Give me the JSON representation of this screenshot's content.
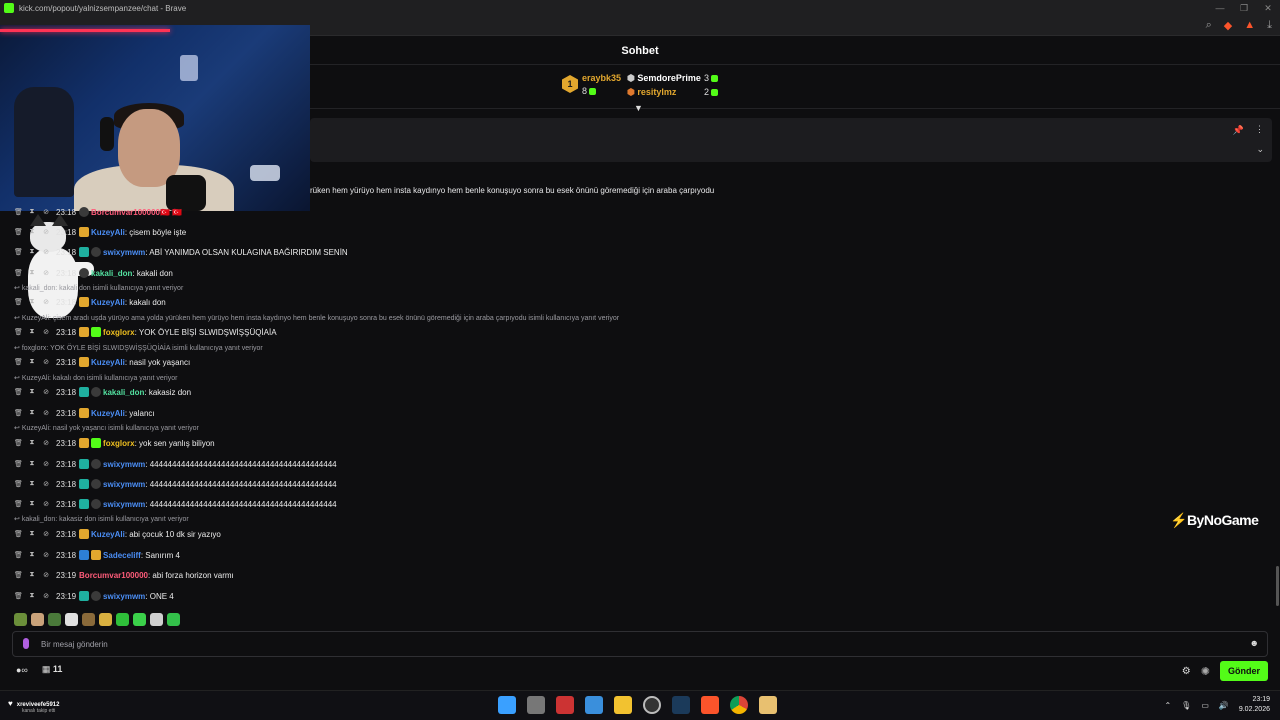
{
  "browser": {
    "title": "kick.com/popout/yalnizsempanzee/chat - Brave",
    "controls": [
      "—",
      "❐",
      "✕"
    ]
  },
  "chat": {
    "header": "Sohbet",
    "leaderboard": {
      "rank": "1",
      "first": {
        "name": "eraybk35",
        "count": "8"
      },
      "second": {
        "name": "SemdorePrime",
        "count": "3"
      },
      "third": {
        "name": "resitylmz",
        "count": "2"
      }
    },
    "long_message": "rüken hem yürüyo hem insta kaydınyo hem benle konuşuyo sonra bu esek önünü göremediği için araba çarpıyodu",
    "messages": [
      {
        "time": "23:18",
        "name": "Borcumvar100000",
        "color": "#ff5c7a",
        "text": "🇹🇷 🇹🇷",
        "badges": [
          "b-dark"
        ]
      },
      {
        "time": "23:18",
        "name": "KuzeyAli",
        "color": "#4b8ef5",
        "text": ": çisem böyle işte",
        "badges": [
          "b-sub"
        ]
      },
      {
        "time": "23:18",
        "name": "swixymwm",
        "color": "#4b8ef5",
        "text": ": ABİ YANIMDA OLSAN KULAGINA BAĞIRIRDIM SENİN",
        "badges": [
          "b-mod",
          "b-dark"
        ]
      },
      {
        "time": "23:18",
        "name": "kakali_don",
        "color": "#53e0a0",
        "text": ": kakali don",
        "badges": [
          "b-dark"
        ]
      },
      {
        "time": "23:18",
        "name": "KuzeyAli",
        "color": "#4b8ef5",
        "text": ": kakalı don",
        "badges": [
          "b-sub"
        ]
      },
      {
        "time": "23:18",
        "name": "foxglorx",
        "color": "#f0c020",
        "text": ": YOK ÖYLE BİŞİ SLWIDŞWİŞŞÜQİAİA",
        "badges": [
          "b-sub",
          "b-green"
        ]
      },
      {
        "time": "23:18",
        "name": "KuzeyAli",
        "color": "#4b8ef5",
        "text": ": nasil yok yaşancı",
        "badges": [
          "b-sub"
        ]
      },
      {
        "time": "23:18",
        "name": "kakali_don",
        "color": "#53e0a0",
        "text": ": kakasiz don",
        "badges": [
          "b-mod",
          "b-dark"
        ]
      },
      {
        "time": "23:18",
        "name": "KuzeyAli",
        "color": "#4b8ef5",
        "text": ": yalancı",
        "badges": [
          "b-sub"
        ]
      },
      {
        "time": "23:18",
        "name": "foxglorx",
        "color": "#f0c020",
        "text": ": yok sen yanlış biliyon",
        "badges": [
          "b-sub",
          "b-green"
        ]
      },
      {
        "time": "23:18",
        "name": "swixymwm",
        "color": "#4b8ef5",
        "text": ": 444444444444444444444444444444444444444444",
        "badges": [
          "b-mod",
          "b-dark"
        ]
      },
      {
        "time": "23:18",
        "name": "swixymwm",
        "color": "#4b8ef5",
        "text": ": 444444444444444444444444444444444444444444",
        "badges": [
          "b-mod",
          "b-dark"
        ]
      },
      {
        "time": "23:18",
        "name": "swixymwm",
        "color": "#4b8ef5",
        "text": ": 444444444444444444444444444444444444444444",
        "badges": [
          "b-mod",
          "b-dark"
        ]
      },
      {
        "time": "23:18",
        "name": "KuzeyAli",
        "color": "#4b8ef5",
        "text": ": abi çocuk 10 dk sir yazıyo",
        "badges": [
          "b-sub"
        ]
      },
      {
        "time": "23:18",
        "name": "Sadeceliff",
        "color": "#4b8ef5",
        "text": ": Sanırım 4",
        "badges": [
          "b-blue",
          "b-sub"
        ]
      },
      {
        "time": "23:19",
        "name": "Borcumvar100000",
        "color": "#ff5c7a",
        "text": ": abi forza horizon varmı",
        "badges": []
      },
      {
        "time": "23:19",
        "name": "swixymwm",
        "color": "#4b8ef5",
        "text": ": ONE 4",
        "badges": [
          "b-mod",
          "b-dark"
        ]
      }
    ],
    "replies": [
      "kakali_don: kakali don isimli kullanıcıya yanıt veriyor",
      "KuzeyAli: çisem aradı uşda yürüyo ama yolda yürüken hem yürüyo hem insta kaydınyo hem benle konuşuyo sonra bu esek önünü göremediği için araba çarpıyodu isimli kullanıcıya yanıt veriyor",
      "foxglorx: YOK ÖYLE BİŞİ SLWIDŞWİŞŞÜQİAİA isimli kullanıcıya yanıt veriyor",
      "KuzeyAli: kakalı don isimli kullanıcıya yanıt veriyor",
      "KuzeyAli: nasil yok yaşancı isimli kullanıcıya yanıt veriyor",
      "kakali_don: kakasiz don isimli kullanıcıya yanıt veriyor"
    ],
    "input_placeholder": "Bir mesaj gönderin",
    "footer_count": "11",
    "send_label": "Gönder"
  },
  "watermark": "ByNoGame",
  "taskbar": {
    "notif_name": "xreviveefe5912",
    "notif_sub": "kanalı takip etti",
    "time": "23:19",
    "date": "9.02.2026"
  },
  "colors": {
    "accent": "#53fc18",
    "background": "#0e0e10"
  }
}
